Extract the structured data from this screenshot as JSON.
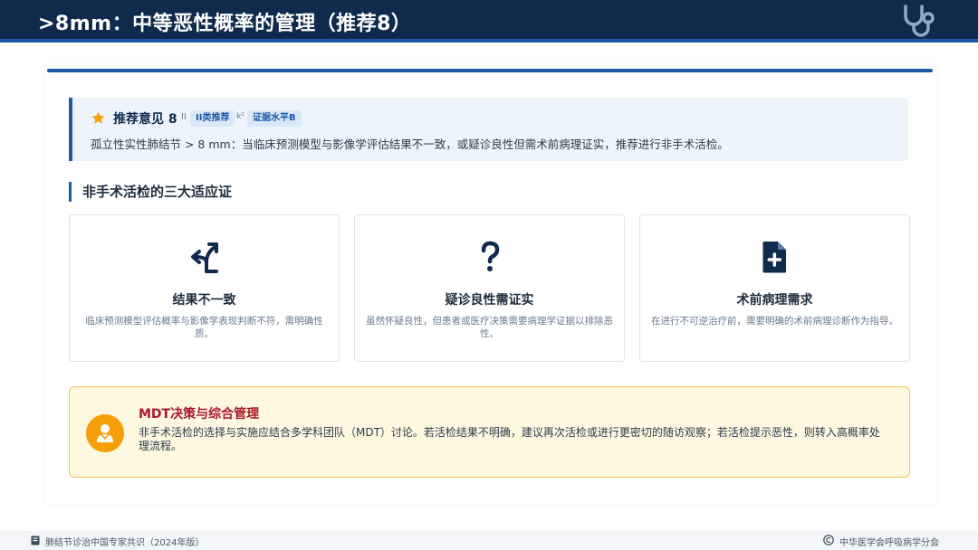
{
  "header": {
    "title": ">8mm：中等恶性概率的管理（推荐8）",
    "logo_icon": "stethoscope-icon"
  },
  "recommendation": {
    "icon": "star-icon",
    "title": "推荐意见 8",
    "fragment_1": "II",
    "badge_class": "II类推荐",
    "fragment_2": "k²",
    "badge_evidence": "证据水平B",
    "text": "孤立性实性肺结节 > 8 mm：当临床预测模型与影像学评估结果不一致，或疑诊良性但需术前病理证实，推荐进行非手术活检。"
  },
  "section": {
    "title": "非手术活检的三大适应证"
  },
  "cards": [
    {
      "icon": "diverging-arrows-icon",
      "title": "结果不一致",
      "description": "临床预测模型评估概率与影像学表现判断不符，需明确性质。"
    },
    {
      "icon": "question-mark-icon",
      "title": "疑诊良性需证实",
      "description": "虽然怀疑良性，但患者或医疗决策需要病理学证据以排除恶性。"
    },
    {
      "icon": "medical-file-icon",
      "title": "术前病理需求",
      "description": "在进行不可逆治疗前，需要明确的术前病理诊断作为指导。"
    }
  ],
  "mdt": {
    "icon": "doctor-icon",
    "title": "MDT决策与综合管理",
    "text": "非手术活检的选择与实施应结合多学科团队（MDT）讨论。若活检结果不明确，建议再次活检或进行更密切的随访观察；若活检提示恶性，则转入高概率处理流程。"
  },
  "footer": {
    "source": "肺结节诊治中国专家共识（2024年版）",
    "organization": "中华医学会呼吸病学分会"
  },
  "colors": {
    "header_bg": "#0f2a4d",
    "accent": "#1c5aa6",
    "mdt_bg": "#fff8e1",
    "mdt_title": "#a8182a",
    "mdt_icon_bg": "#f5a00a"
  }
}
